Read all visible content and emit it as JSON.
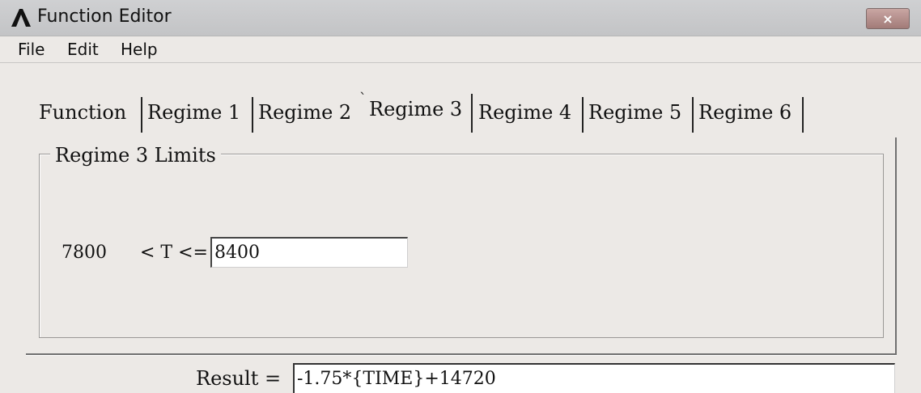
{
  "window": {
    "title": "Function Editor",
    "close_symbol": "×",
    "logo_icon": "ansys-logo-icon"
  },
  "menu": {
    "items": [
      {
        "label": "File"
      },
      {
        "label": "Edit"
      },
      {
        "label": "Help"
      }
    ]
  },
  "tabs": {
    "items": [
      {
        "label": "Function"
      },
      {
        "label": "Regime 1"
      },
      {
        "label": "Regime 2"
      },
      {
        "label": "Regime 3",
        "active": true
      },
      {
        "label": "Regime 4"
      },
      {
        "label": "Regime 5"
      },
      {
        "label": "Regime 6"
      }
    ]
  },
  "regime_group": {
    "title": "Regime 3 Limits",
    "lower_limit": "7800",
    "relation_label": "< T <=",
    "upper_limit_value": "8400"
  },
  "result": {
    "label": "Result =",
    "value": "-1.75*{TIME}+14720"
  },
  "colors": {
    "window_bg": "#ece9e6",
    "close_button": "#b38e8b",
    "input_bg": "#ffffff"
  }
}
